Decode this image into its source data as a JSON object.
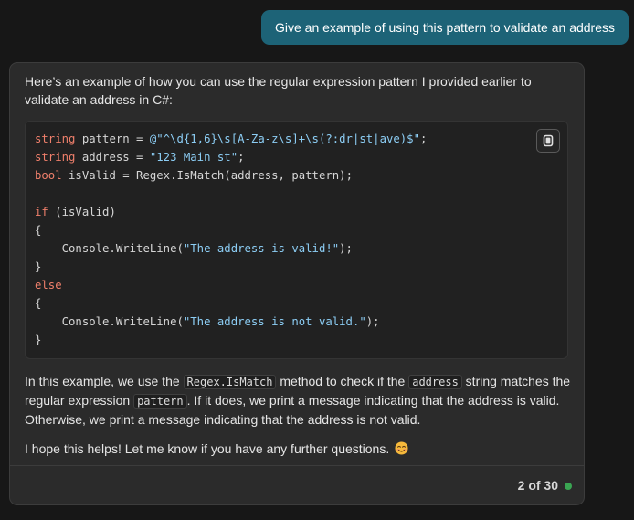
{
  "user_message": "Give an example of using this pattern to validate an address",
  "reply": {
    "intro": "Here’s an example of how you can use the regular expression pattern I provided earlier to validate an address in C#:",
    "code": {
      "l1_kw": "string",
      "l1_mid": " pattern = ",
      "l1_str": "@\"^\\d{1,6}\\s[A-Za-z\\s]+\\s(?:dr|st|ave)$\"",
      "l1_end": ";",
      "l2_kw": "string",
      "l2_mid": " address = ",
      "l2_str": "\"123 Main st\"",
      "l2_end": ";",
      "l3_kw": "bool",
      "l3_rest": " isValid = Regex.IsMatch(address, pattern);",
      "l5_kw": "if",
      "l5_rest": " (isValid)",
      "brace_open": "{",
      "brace_close": "}",
      "call_prefix": "    Console.WriteLine(",
      "valid_msg": "\"The address is valid!\"",
      "call_suffix": ");",
      "else_kw": "else",
      "invalid_msg": "\"The address is not valid.\""
    },
    "explain": {
      "t1": "In this example, we use the ",
      "c1": "Regex.IsMatch",
      "t2": " method to check if the ",
      "c2": "address",
      "t3": " string matches the regular expression ",
      "c3": "pattern",
      "t4": ". If it does, we print a message indicating that the address is valid. Otherwise, we print a message indicating that the address is not valid."
    },
    "closing": "I hope this helps! Let me know if you have any further questions.",
    "emoji": "smiling-face-emoji",
    "copy_icon": "copy-icon",
    "footer": {
      "counter": "2 of 30",
      "status_color": "#3aa552"
    }
  },
  "colors": {
    "user_bubble": "#1d6377",
    "keyword": "#ef7f6b",
    "string": "#8ccdf4"
  }
}
